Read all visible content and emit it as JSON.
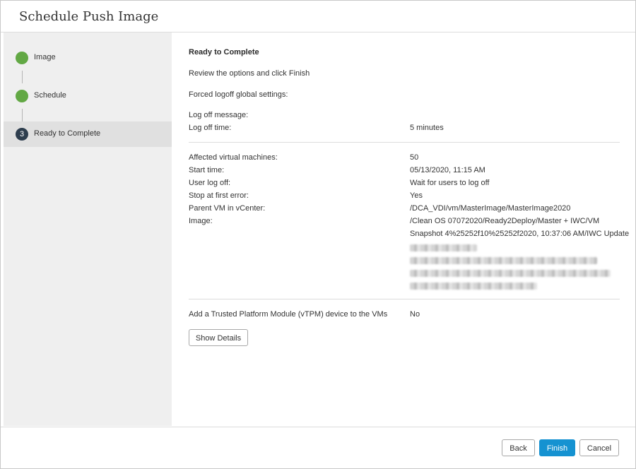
{
  "dialog": {
    "title": "Schedule Push Image"
  },
  "steps": [
    {
      "label": "Image",
      "state": "done"
    },
    {
      "label": "Schedule",
      "state": "done"
    },
    {
      "label": "Ready to Complete",
      "state": "current",
      "number": "3"
    }
  ],
  "content": {
    "heading": "Ready to Complete",
    "intro": "Review the options and click Finish",
    "forced_logoff": "Forced logoff global settings:",
    "logoff_message_label": "Log off message:",
    "logoff_time_label": "Log off time:",
    "logoff_time_value": "5 minutes",
    "summary": [
      {
        "label": "Affected virtual machines:",
        "value": "50"
      },
      {
        "label": "Start time:",
        "value": "05/13/2020, 11:15 AM"
      },
      {
        "label": "User log off:",
        "value": "Wait for users to log off"
      },
      {
        "label": "Stop at first error:",
        "value": "Yes"
      },
      {
        "label": "Parent VM in vCenter:",
        "value": "/DCA_VDI/vm/MasterImage/MasterImage2020"
      },
      {
        "label": "Image:",
        "value": "/Clean OS 07072020/Ready2Deploy/Master + IWC/VM"
      }
    ],
    "image_line2": "Snapshot 4%25252f10%25252f2020, 10:37:06 AM/IWC Update",
    "vtpm_label": "Add a Trusted Platform Module (vTPM) device to the VMs",
    "vtpm_value": "No",
    "show_details": "Show Details"
  },
  "footer": {
    "back": "Back",
    "finish": "Finish",
    "cancel": "Cancel"
  },
  "colors": {
    "done": "#62a844",
    "current": "#2e3e4e",
    "primary": "#1592d1"
  }
}
